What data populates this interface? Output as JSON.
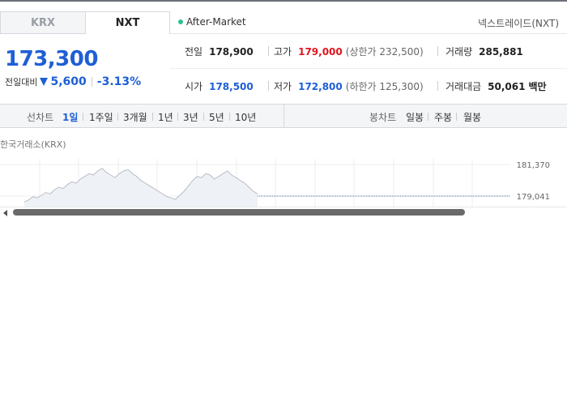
{
  "tabs": [
    {
      "label": "KRX",
      "active": false
    },
    {
      "label": "NXT",
      "active": true
    }
  ],
  "session": "After-Market",
  "exchange": "넥스트레이드(NXT)",
  "price": "173,300",
  "change": {
    "label": "전일대비",
    "amount": "5,600",
    "percent": "-3.13%",
    "direction": "down"
  },
  "quotes": {
    "prev_close": {
      "label": "전일",
      "value": "178,900"
    },
    "high": {
      "label": "고가",
      "value": "179,000",
      "limit_label": "상한가",
      "limit_value": "232,500"
    },
    "volume": {
      "label": "거래량",
      "value": "285,881"
    },
    "open": {
      "label": "시가",
      "value": "178,500"
    },
    "low": {
      "label": "저가",
      "value": "172,800",
      "limit_label": "하한가",
      "limit_value": "125,300"
    },
    "amount": {
      "label": "거래대금",
      "value": "50,061",
      "unit": "백만"
    }
  },
  "line_chart": {
    "label": "선차트",
    "periods": [
      "1일",
      "1주일",
      "3개월",
      "1년",
      "3년",
      "5년",
      "10년"
    ],
    "selected": "1일"
  },
  "candle_chart": {
    "label": "봉차트",
    "periods": [
      "일봉",
      "주봉",
      "월봉"
    ]
  },
  "chart_caption": "한국거래소(KRX)",
  "colors": {
    "up": "#e0161e",
    "down": "#1e5fd6",
    "session_dot": "#2bc28a"
  },
  "chart_data": {
    "type": "line",
    "ylim": [
      178200,
      181800
    ],
    "yticks": [
      "181,370",
      "179,041"
    ],
    "ytick_values": [
      181370,
      179041
    ],
    "reference_value": 179041,
    "values": [
      178600,
      178750,
      179000,
      178900,
      179100,
      179300,
      179200,
      179500,
      179700,
      179600,
      179900,
      180100,
      180000,
      180300,
      180500,
      180700,
      180600,
      180900,
      181100,
      180800,
      180600,
      180400,
      180700,
      180900,
      181000,
      180700,
      180500,
      180200,
      180000,
      179800,
      179600,
      179400,
      179200,
      179000,
      178900,
      178800,
      179100,
      179400,
      179800,
      180200,
      180500,
      180400,
      180700,
      180600,
      180300,
      180500,
      180700,
      180900,
      180600,
      180400,
      180200,
      180000,
      179700,
      179400,
      179200
    ]
  }
}
